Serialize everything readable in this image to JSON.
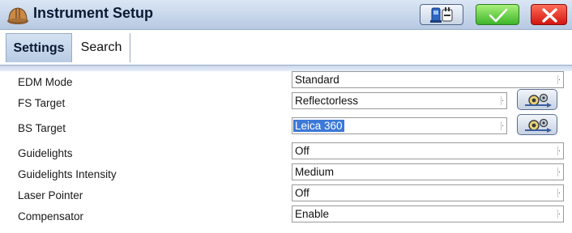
{
  "window": {
    "title": "Instrument Setup",
    "icon": "hard-hat-icon"
  },
  "toolbar": {
    "config_button_icon": "instrument-settings-icon",
    "ok_button_icon": "checkmark-icon",
    "cancel_button_icon": "close-x-icon",
    "ok_color": "#3eb52a",
    "cancel_color": "#d31510"
  },
  "tabs": [
    {
      "label": "Settings",
      "active": true
    },
    {
      "label": "Search",
      "active": false
    }
  ],
  "form": {
    "edm_mode": {
      "label": "EDM Mode",
      "value": "Standard"
    },
    "fs_target": {
      "label": "FS Target",
      "value": "Reflectorless",
      "settings_icon": "target-settings-icon"
    },
    "bs_target": {
      "label": "BS Target",
      "value": "Leica 360",
      "selected": true,
      "settings_icon": "target-settings-icon"
    },
    "guidelights": {
      "label": "Guidelights",
      "value": "Off"
    },
    "guidelights_intensity": {
      "label": "Guidelights Intensity",
      "value": "Medium"
    },
    "laser_pointer": {
      "label": "Laser Pointer",
      "value": "Off"
    },
    "compensator": {
      "label": "Compensator",
      "value": "Enable"
    }
  },
  "colors": {
    "title_bar": "#c6d6ea",
    "active_tab": "#c5d6ec",
    "selection": "#3c78d8"
  }
}
